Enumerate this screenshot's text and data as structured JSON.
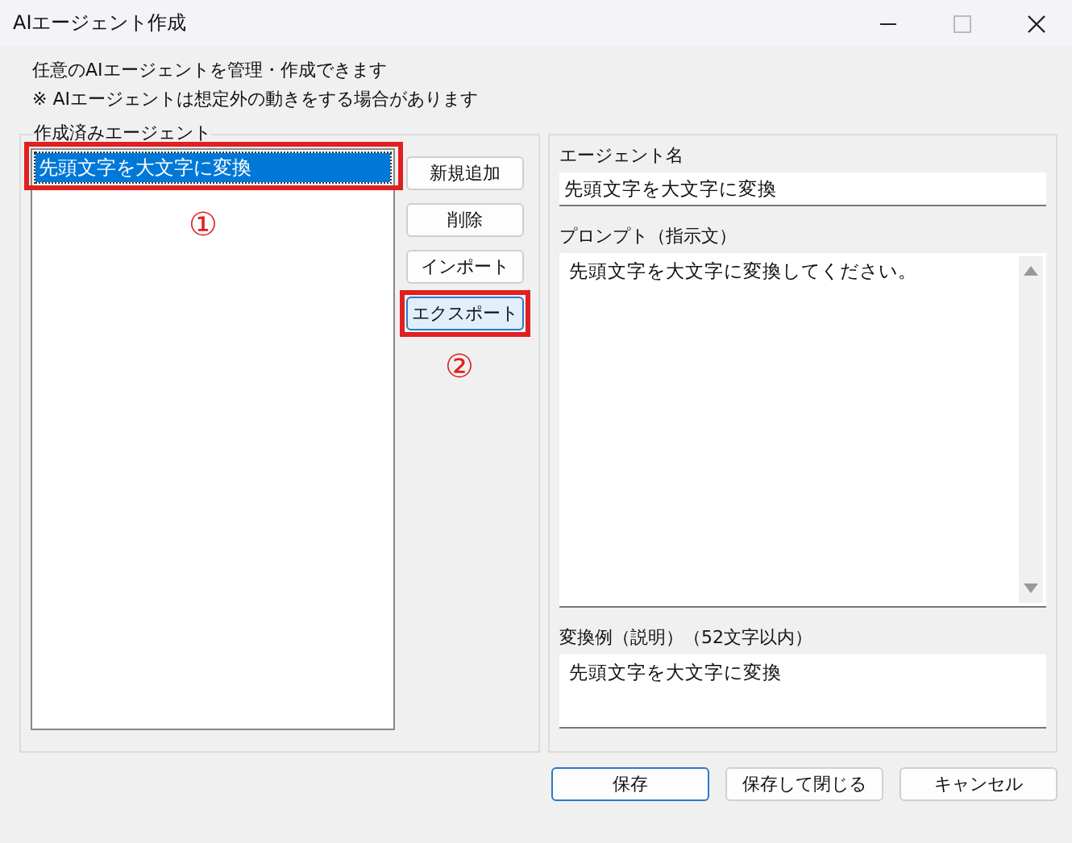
{
  "window": {
    "title": "AIエージェント作成"
  },
  "description": [
    "任意のAIエージェントを管理・作成できます",
    "※ AIエージェントは想定外の動きをする場合があります"
  ],
  "agent_group": {
    "label": "作成済みエージェント",
    "agents": [
      {
        "name": "先頭文字を大文字に変換",
        "selected": true
      }
    ]
  },
  "buttons": [
    {
      "label": "新規追加",
      "focused": false
    },
    {
      "label": "削除",
      "focused": false
    },
    {
      "label": "インポート",
      "focused": false
    },
    {
      "label": "エクスポート",
      "focused": true
    }
  ],
  "editor": {
    "name_label": "エージェント名",
    "name_value": "先頭文字を大文字に変換",
    "prompt_label": "プロンプト（指示文）",
    "prompt_value": "先頭文字を大文字に変換してください。",
    "example_label": "変換例（説明）（52文字以内）",
    "example_value": "先頭文字を大文字に変換"
  },
  "footer_buttons": [
    {
      "label": "保存",
      "default": true
    },
    {
      "label": "保存して閉じる",
      "default": false
    },
    {
      "label": "キャンセル",
      "default": false
    }
  ],
  "annotations": [
    {
      "label": "①"
    },
    {
      "label": "②"
    }
  ]
}
